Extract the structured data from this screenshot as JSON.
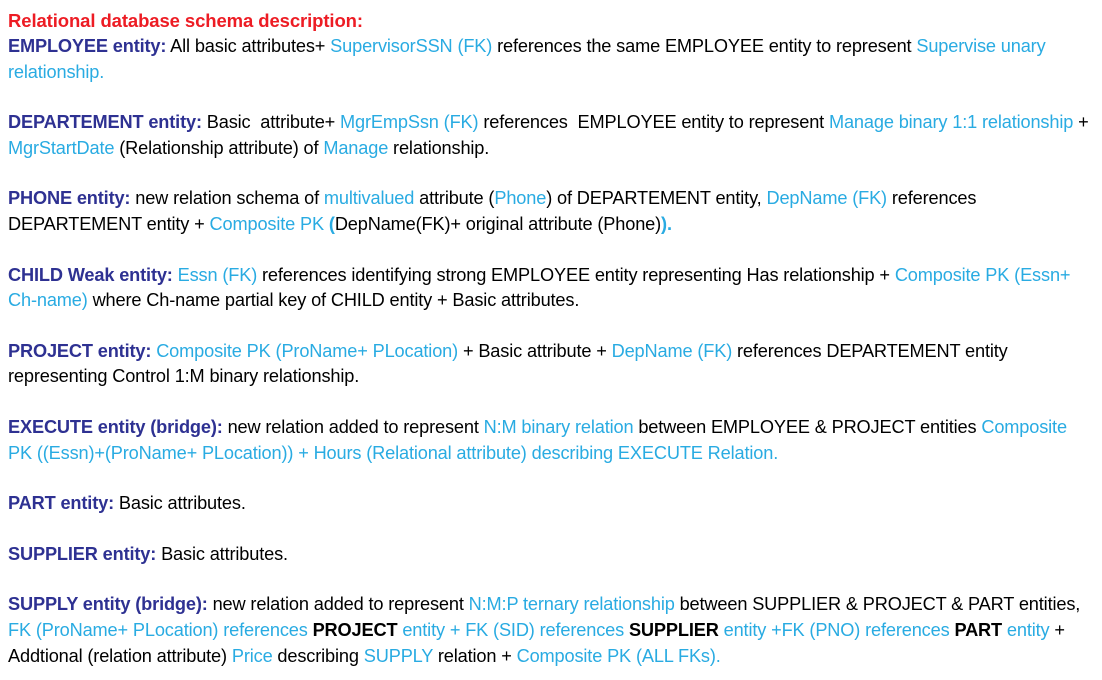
{
  "document": {
    "title": "Relational database schema description:",
    "colors": {
      "title_red": "#ED1C24",
      "entity_heading_navy": "#2E3192",
      "accent_blue": "#29ABE2",
      "body_black": "#000000",
      "background": "#FFFFFF"
    }
  },
  "paragraphs": [
    {
      "id": "employee",
      "name": "employee-entity-paragraph",
      "runs": [
        {
          "text": "EMPLOYEE entity:",
          "style": "head"
        },
        {
          "text": " All basic attributes+ ",
          "style": "plain"
        },
        {
          "text": "SupervisorSSN (FK)",
          "style": "accent"
        },
        {
          "text": " references the same EMPLOYEE entity to represent ",
          "style": "plain"
        },
        {
          "text": "Supervise unary relationship.",
          "style": "accent"
        }
      ]
    },
    {
      "id": "departement",
      "name": "departement-entity-paragraph",
      "runs": [
        {
          "text": "DEPARTEMENT entity:",
          "style": "head"
        },
        {
          "text": " Basic  attribute+ ",
          "style": "plain"
        },
        {
          "text": "MgrEmpSsn (FK)",
          "style": "accent"
        },
        {
          "text": " references  EMPLOYEE entity to represent ",
          "style": "plain"
        },
        {
          "text": "Manage binary 1:1 relationship",
          "style": "accent"
        },
        {
          "text": " + ",
          "style": "plain"
        },
        {
          "text": "MgrStartDate",
          "style": "accent"
        },
        {
          "text": " (Relationship attribute) of ",
          "style": "plain"
        },
        {
          "text": "Manage",
          "style": "accent"
        },
        {
          "text": " relationship.",
          "style": "plain"
        }
      ]
    },
    {
      "id": "phone",
      "name": "phone-entity-paragraph",
      "runs": [
        {
          "text": "PHONE entity:",
          "style": "head"
        },
        {
          "text": " new relation schema of ",
          "style": "plain"
        },
        {
          "text": "multivalued",
          "style": "accent"
        },
        {
          "text": " attribute (",
          "style": "plain"
        },
        {
          "text": "Phone",
          "style": "accent"
        },
        {
          "text": ") of DEPARTEMENT entity, ",
          "style": "plain"
        },
        {
          "text": "DepName (FK)",
          "style": "accent"
        },
        {
          "text": " references DEPARTEMENT entity + ",
          "style": "plain"
        },
        {
          "text": "Composite PK ",
          "style": "accent"
        },
        {
          "text": "(",
          "style": "accent-bold"
        },
        {
          "text": "DepName(FK)+ original attribute (Phone)",
          "style": "plain"
        },
        {
          "text": ").",
          "style": "accent-bold"
        }
      ]
    },
    {
      "id": "child",
      "name": "child-weak-entity-paragraph",
      "runs": [
        {
          "text": "CHILD Weak entity:",
          "style": "head"
        },
        {
          "text": " ",
          "style": "plain"
        },
        {
          "text": "Essn (FK)",
          "style": "accent"
        },
        {
          "text": " references identifying strong EMPLOYEE entity representing Has relationship + ",
          "style": "plain"
        },
        {
          "text": "Composite PK (Essn+ Ch-name)",
          "style": "accent"
        },
        {
          "text": " where Ch-name partial key of CHILD entity + Basic attributes.",
          "style": "plain"
        }
      ]
    },
    {
      "id": "project",
      "name": "project-entity-paragraph",
      "runs": [
        {
          "text": "PROJECT entity:",
          "style": "head"
        },
        {
          "text": " ",
          "style": "plain"
        },
        {
          "text": "Composite PK (ProName+ PLocation)",
          "style": "accent"
        },
        {
          "text": " + Basic attribute + ",
          "style": "plain"
        },
        {
          "text": "DepName (FK)",
          "style": "accent"
        },
        {
          "text": " references DEPARTEMENT entity representing Control 1:M binary relationship.",
          "style": "plain"
        }
      ]
    },
    {
      "id": "execute",
      "name": "execute-entity-paragraph",
      "runs": [
        {
          "text": "EXECUTE entity (bridge):",
          "style": "head"
        },
        {
          "text": " new relation added to represent ",
          "style": "plain"
        },
        {
          "text": "N:M binary relation",
          "style": "accent"
        },
        {
          "text": " between EMPLOYEE & PROJECT entities ",
          "style": "plain"
        },
        {
          "text": "Composite PK ((Essn)+(ProName+ PLocation)) + Hours (Relational attribute) describing EXECUTE Relation.",
          "style": "accent"
        }
      ]
    },
    {
      "id": "part",
      "name": "part-entity-paragraph",
      "runs": [
        {
          "text": "PART entity:",
          "style": "head"
        },
        {
          "text": " Basic attributes.",
          "style": "plain"
        }
      ]
    },
    {
      "id": "supplier",
      "name": "supplier-entity-paragraph",
      "runs": [
        {
          "text": "SUPPLIER entity:",
          "style": "head"
        },
        {
          "text": " Basic attributes.",
          "style": "plain"
        }
      ]
    },
    {
      "id": "supply",
      "name": "supply-entity-paragraph",
      "runs": [
        {
          "text": "SUPPLY entity (bridge):",
          "style": "head"
        },
        {
          "text": " new relation added to represent ",
          "style": "plain"
        },
        {
          "text": "N:M:P ternary relationship",
          "style": "accent"
        },
        {
          "text": " between SUPPLIER & PROJECT & PART entities, ",
          "style": "plain"
        },
        {
          "text": "FK (ProName+ PLocation) references ",
          "style": "accent"
        },
        {
          "text": "PROJECT",
          "style": "plain-bold"
        },
        {
          "text": " entity + FK (SID) references ",
          "style": "accent"
        },
        {
          "text": "SUPPLIER",
          "style": "plain-bold"
        },
        {
          "text": " entity +",
          "style": "accent"
        },
        {
          "text": "FK (PNO) references ",
          "style": "accent"
        },
        {
          "text": "PART",
          "style": "plain-bold"
        },
        {
          "text": " entity",
          "style": "accent"
        },
        {
          "text": " + Addtional (relation attribute) ",
          "style": "plain"
        },
        {
          "text": "Price",
          "style": "accent"
        },
        {
          "text": " describing ",
          "style": "plain"
        },
        {
          "text": "SUPPLY",
          "style": "accent"
        },
        {
          "text": " relation + ",
          "style": "plain"
        },
        {
          "text": "Composite PK (ALL FKs).",
          "style": "accent"
        }
      ]
    }
  ]
}
